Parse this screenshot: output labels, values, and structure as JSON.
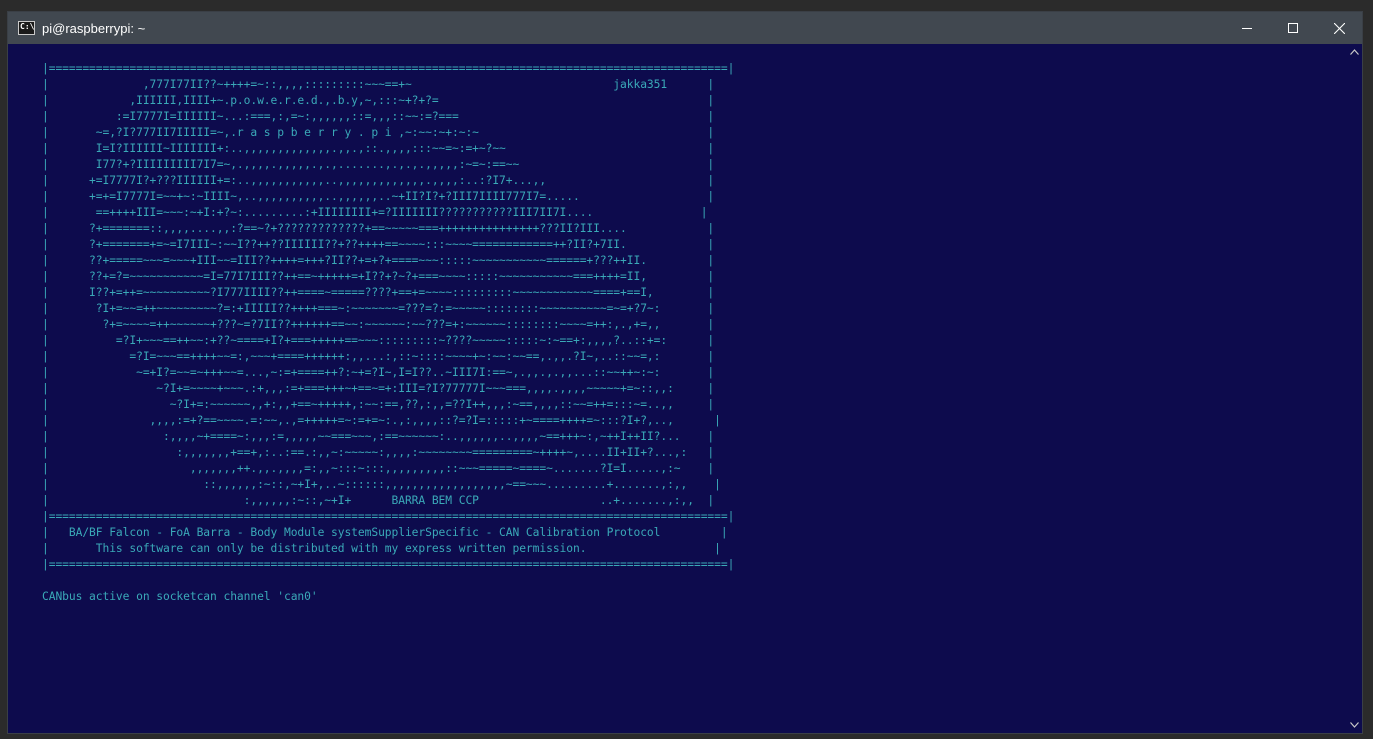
{
  "window": {
    "title": "pi@raspberrypi: ~",
    "icon_label": "C:\\",
    "controls": [
      "minimize-icon",
      "maximize-icon",
      "close-icon"
    ]
  },
  "terminal": {
    "lines": [
      "|=====================================================================================================|",
      "|              ,777I77II??~++++=~::,,,,:::::::::~~~==+~                              jakka351      |",
      "|            ,IIIIII,IIII+~.p.o.w.e.r.e.d.,.b.y,~,:::~+?+?=                                        |",
      "|          :=I7777I=IIIIII~...:===,:,=~:,,,,,,::=,,,::~~:=?===                                     |",
      "|       ~=,?I?777II7IIIII=~,.r a s p b e r r y . p i ,~:~~:~+:~:~                                  |",
      "|       I=I?IIIIII~IIIIIII+:..,,,,,,,,,,,,,.,,.,::.,,,,:::~~=~:=+~?~~                              |",
      "|       I77?+?IIIIIIIII7I7=~,.,,,,.,,,,,.,.,.......,.,.,.,,,,,:~=~:==~~                            |",
      "|      +=I7777I?+???IIIIII+=:..,,,,,,,,,,,..,,,,,,,,,,,,,.,,,,:..:?I7+...,,                        |",
      "|      +=+=I7777I=~~+~:~IIII~,..,,,,,,,,,,..,,,,,,..~+II?I?+?III7IIII777I7=.....                   |",
      "|       ==++++III=~~~:~+I:+?~:.........:+IIIIIIII+=?IIIIIII???????????III7II7I....                |",
      "|      ?+=======::,,,,....,,:?==~?+?????????????+==~~~~~===+++++++++++++++???II?III....            |",
      "|      ?+=======+=~=I7III~:~~I??++??IIIIII??+??++++==~~~~:::~~~~============++?II?+7II.            |",
      "|      ??+=====~~~=~~~+III~~=III??++++=+++?II??+=+?+====~~~:::::~~~~~~~~~~~======+???++II.         |",
      "|      ??+=?=~~~~~~~~~~~=I=77I7III??++==~+++++=+I??+?~?+===~~~~:::::~~~~~~~~~~~===++++=II,         |",
      "|      I??+=++=~~~~~~~~~~?I777IIII??++====~=====????+==+=~~~~:::::::::~~~~~~~~~~~~====+==I,        |",
      "|       ?I+=~~=++~~~~~~~~~?=:+IIIII??++++===~:~~~~~~~=???=?:=~~~~~::::::::~~~~~~~~~~=~=+?7~:       |",
      "|        ?+=~~~~=++~~~~~~+???~=?7II??++++++==~~:~~~~~~:~~???=+:~~~~~~::::::::~~~~=++:,.,+=,,       |",
      "|          =?I+~~~==++~~:+??~====+I?+===+++++==~~~:::::::::~????~~~~~:::::~:~==+:,,,,?..::+=:      |",
      "|            =?I=~~~==++++~~=:,~~~+====++++++:,,...:,::~::::~~~~+~:~~:~~==,.,,.?I~,..::~~=,:       |",
      "|             ~=+I?=~~=~+++~~=...,~:=+====++?:~+=?I~,I=I??..~III7I:==~,.,,.,.,,...::~~++~:~:       |",
      "|                ~?I+=~~~~+~~~.:+,,,:=+===+++~+==~=+:III=?I?77777I~~~===,,,,.,,,,~~~~~+=~::,,:     |",
      "|                  ~?I+=:~~~~~~,,+:,,+==~+++++,:~~:==,??,:,,=??I++,,,:~==,,,,::~~=++=:::~=..,,     |",
      "|               ,,,,:=+?==~~~~.=:~~,.,=+++++=~:=+=~:.,:,,,,::?=?I=:::::+~====++++=~:::?I+?,..,      |",
      "|                 :,,,,~+====~:,,,:=,,,,,~~===~~~,:==~~~~~~:..,,,,,,..,,,,~==+++~:,~++I++II?...    |",
      "|                   :,,,,,,,+==+,:..:==.:,,~:~~~~~:,,,,:~~~~~~~~=========~++++~,....II+II+?...,:   |",
      "|                     ,,,,,,,++.,,.,,,,=:,,~:::~:::,,,,,,,,,::~~~=====~====~.......?I=I.....,:~    |",
      "|                       ::,,,,,,:~::,~+I+,..~::::::,,,,,,,,,,,,,,,,,,~==~~~.........+.......,:,,    |",
      "|                             :,,,,,,:~::,~+I+      BARRA BEM CCP                  ..+.......,:,,  |",
      "|=====================================================================================================|",
      "|   BA/BF Falcon - FoA Barra - Body Module systemSupplierSpecific - CAN Calibration Protocol         |",
      "|       This software can only be distributed with my express written permission.                   |",
      "|=====================================================================================================|",
      "",
      "CANbus active on socketcan channel 'can0'"
    ]
  },
  "colors": {
    "titlebar": "#414850",
    "terminal_bg": "#0d0b4d",
    "terminal_fg": "#3aa9b8"
  }
}
